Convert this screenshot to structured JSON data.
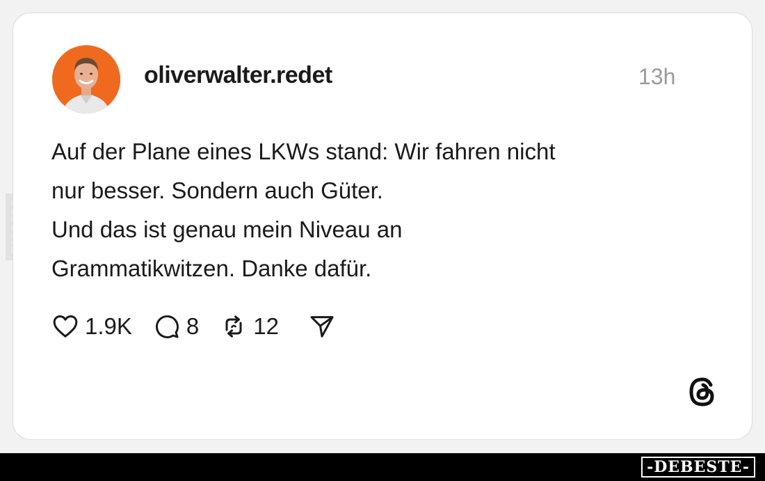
{
  "post": {
    "username": "oliverwalter.redet",
    "timestamp": "13h",
    "avatar_icon": "profile-photo",
    "text_lines": [
      "Auf der Plane eines LKWs stand: Wir fahren nicht",
      "nur besser. Sondern auch Güter.",
      "Und das ist genau mein Niveau an",
      "Grammatikwitzen. Danke dafür."
    ]
  },
  "actions": {
    "likes": "1.9K",
    "comments": "8",
    "reposts": "12",
    "icons": [
      "heart-icon",
      "comment-icon",
      "repost-icon",
      "share-icon"
    ]
  },
  "brand": {
    "app_icon": "threads-logo-icon"
  },
  "watermark": {
    "side_text": "DEBESTE",
    "footer_text": "-DEBESTE-"
  },
  "colors": {
    "avatar_bg": "#ef6a1e",
    "text": "#1a1a1a",
    "muted": "#9a9a9a",
    "footer_bg": "#000000"
  }
}
